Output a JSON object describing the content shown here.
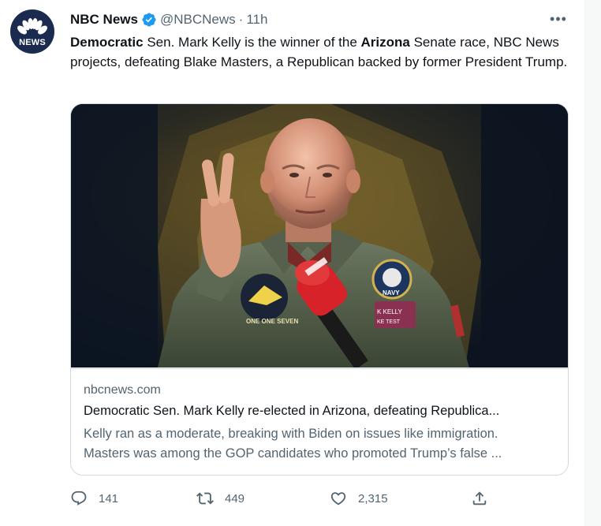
{
  "tweet": {
    "author_name": "NBC News",
    "handle": "@NBCNews",
    "separator": "·",
    "time": "11h",
    "more_label": "•••",
    "avatar_text": "NEWS",
    "text": {
      "part1": "Democratic",
      "part2": " Sen. Mark Kelly is the winner of the ",
      "part3": "Arizona",
      "part4": " Senate race, NBC News projects, defeating Blake Masters, a Republican backed by former President Trump."
    }
  },
  "card": {
    "domain": "nbcnews.com",
    "title": "Democratic Sen. Mark Kelly re-elected in Arizona, defeating Republica...",
    "description_line1": "Kelly ran as a moderate, breaking with Biden on issues like immigration.",
    "description_line2": "Masters was among the GOP candidates who promoted Trump’s false ...",
    "patch_text": "K KELLY",
    "patch_text2": "KE TEST",
    "patch_navy": "NAVY",
    "patch_one": "ONE ONE SEVEN"
  },
  "actions": {
    "reply_count": "141",
    "retweet_count": "449",
    "like_count": "2,315"
  },
  "colors": {
    "verified": "#1d9bf0",
    "secondary_text": "#536471",
    "border": "#cfd9de"
  }
}
